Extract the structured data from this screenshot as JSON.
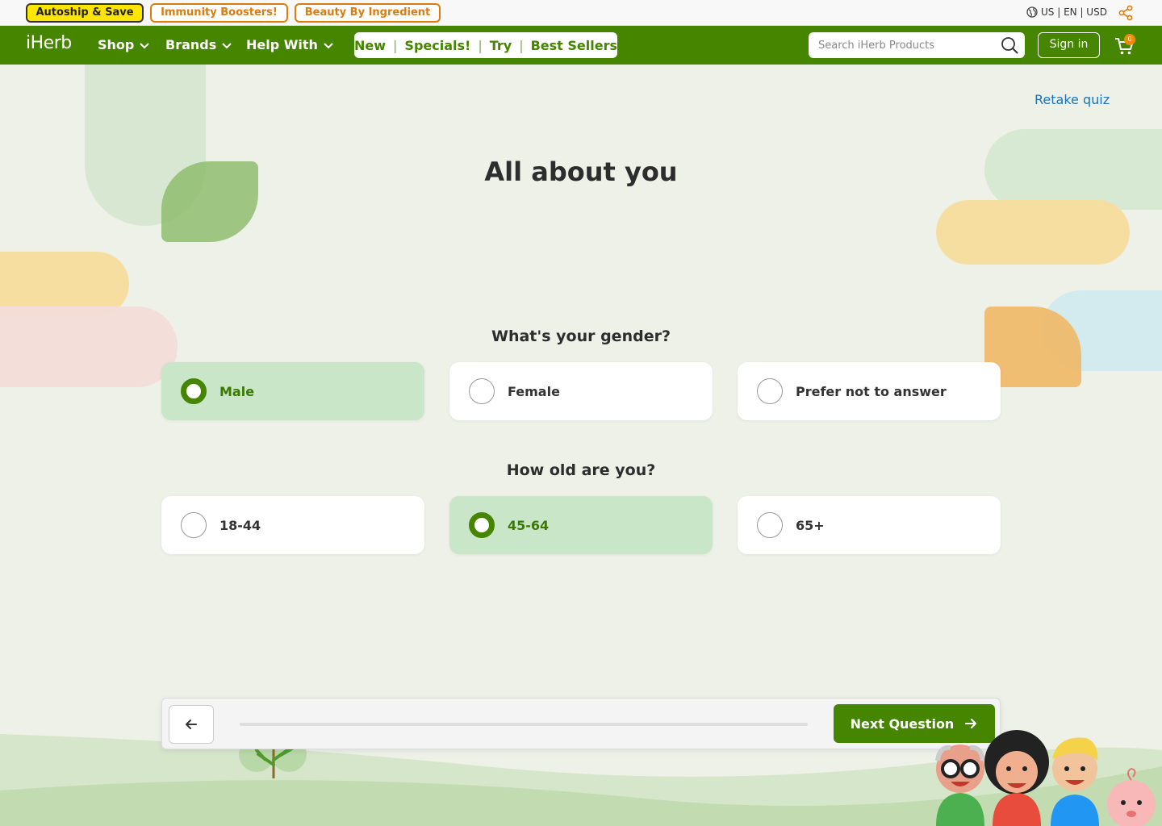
{
  "promo": {
    "pills": [
      "Autoship & Save",
      "Immunity Boosters!",
      "Beauty By Ingredient"
    ],
    "locale": "US | EN | USD",
    "share_icon": "share-icon"
  },
  "nav": {
    "logo": "iHerb",
    "menus": [
      "Shop",
      "Brands",
      "Help With"
    ],
    "quick_links": [
      "New",
      "Specials!",
      "Try",
      "Best Sellers"
    ],
    "search_placeholder": "Search iHerb Products",
    "sign_in": "Sign in",
    "cart_count": "0",
    "brand_color": "#458500",
    "accent_color": "#f28b00"
  },
  "quiz": {
    "retake": "Retake quiz",
    "title": "All about you",
    "gender": {
      "question": "What's your gender?",
      "options": [
        "Male",
        "Female",
        "Prefer not to answer"
      ],
      "selected": "Male"
    },
    "age": {
      "question": "How old are you?",
      "options": [
        "18-44",
        "45-64",
        "65+"
      ],
      "selected": "45-64"
    },
    "progress": 0,
    "next_label": "Next Question"
  }
}
